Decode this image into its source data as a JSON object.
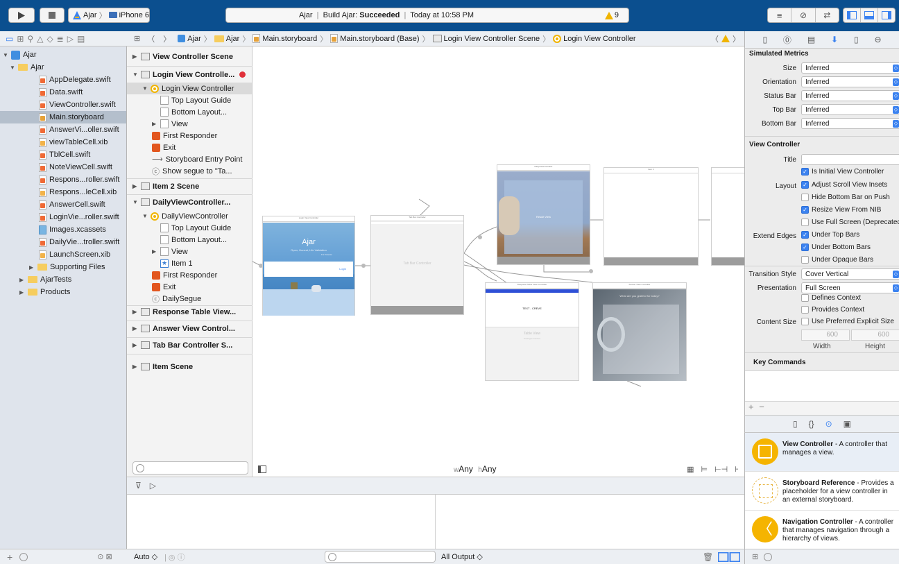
{
  "toolbar": {
    "scheme_name": "Ajar",
    "device_name": "iPhone 6",
    "status_project": "Ajar",
    "status_build_prefix": "Build Ajar: ",
    "status_build_result": "Succeeded",
    "status_time": "Today at 10:58 PM",
    "warning_count": "9"
  },
  "navigator": {
    "items": [
      {
        "label": "Ajar",
        "kind": "project"
      },
      {
        "label": "Ajar",
        "kind": "folder"
      },
      {
        "label": "AppDelegate.swift",
        "kind": "swift"
      },
      {
        "label": "Data.swift",
        "kind": "swift"
      },
      {
        "label": "ViewController.swift",
        "kind": "swift"
      },
      {
        "label": "Main.storyboard",
        "kind": "storyboard"
      },
      {
        "label": "AnswerVi...oller.swift",
        "kind": "swift"
      },
      {
        "label": "viewTableCell.xib",
        "kind": "xib"
      },
      {
        "label": "TblCell.swift",
        "kind": "swift"
      },
      {
        "label": "NoteViewCell.swift",
        "kind": "swift"
      },
      {
        "label": "Respons...roller.swift",
        "kind": "swift"
      },
      {
        "label": "Respons...leCell.xib",
        "kind": "xib"
      },
      {
        "label": "AnswerCell.swift",
        "kind": "swift"
      },
      {
        "label": "LoginVie...roller.swift",
        "kind": "swift"
      },
      {
        "label": "Images.xcassets",
        "kind": "assets"
      },
      {
        "label": "DailyVie...troller.swift",
        "kind": "swift"
      },
      {
        "label": "LaunchScreen.xib",
        "kind": "xib"
      },
      {
        "label": "Supporting Files",
        "kind": "folder"
      },
      {
        "label": "AjarTests",
        "kind": "folder"
      },
      {
        "label": "Products",
        "kind": "folder"
      }
    ]
  },
  "jumpbar": {
    "crumbs": [
      "Ajar",
      "Ajar",
      "Main.storyboard",
      "Main.storyboard (Base)",
      "Login View Controller Scene",
      "Login View Controller"
    ]
  },
  "outline": {
    "rows": [
      {
        "label": "View Controller Scene",
        "head": true
      },
      {
        "label": "Login View Controlle...",
        "head": true
      },
      {
        "label": "Login View Controller"
      },
      {
        "label": "Top Layout Guide"
      },
      {
        "label": "Bottom Layout..."
      },
      {
        "label": "View"
      },
      {
        "label": "First Responder"
      },
      {
        "label": "Exit"
      },
      {
        "label": "Storyboard Entry Point"
      },
      {
        "label": "Show segue to \"Ta..."
      },
      {
        "label": "Item 2 Scene",
        "head": true
      },
      {
        "label": "DailyViewController...",
        "head": true
      },
      {
        "label": "DailyViewController"
      },
      {
        "label": "Top Layout Guide"
      },
      {
        "label": "Bottom Layout..."
      },
      {
        "label": "View"
      },
      {
        "label": "Item 1"
      },
      {
        "label": "First Responder"
      },
      {
        "label": "Exit"
      },
      {
        "label": "DailySegue"
      },
      {
        "label": "Response Table View...",
        "head": true
      },
      {
        "label": "Answer View Control...",
        "head": true
      },
      {
        "label": "Tab Bar Controller S...",
        "head": true
      },
      {
        "label": "Item Scene",
        "head": true
      }
    ]
  },
  "canvas": {
    "login_title": "Login View Controller",
    "login_app": "Ajar",
    "login_tagline": "Open, Honest, Life Validation",
    "login_sub": "For Parents",
    "login_button": "Login",
    "tabbar_title": "Tab Bar Controller",
    "tabbar_label": "Tab Bar Controller",
    "daily_title": "DailyViewController",
    "daily_label": "Result View",
    "item2_title": "Item 2",
    "response_title": "Response Table View Controller",
    "response_cell": "TEXT - CREVE",
    "response_table": "Table View",
    "response_table_sub": "Prototype Content",
    "answer_title": "Answer View Controller",
    "answer_question": "What are you grateful for today?",
    "size_class_w_prefix": "w",
    "size_class_w": "Any",
    "size_class_h_prefix": "h",
    "size_class_h": "Any"
  },
  "debug": {
    "auto_label": "Auto ◇",
    "output_label": "All Output ◇"
  },
  "inspector": {
    "simulated_metrics": "Simulated Metrics",
    "metrics": [
      {
        "label": "Size",
        "value": "Inferred"
      },
      {
        "label": "Orientation",
        "value": "Inferred"
      },
      {
        "label": "Status Bar",
        "value": "Inferred"
      },
      {
        "label": "Top Bar",
        "value": "Inferred"
      },
      {
        "label": "Bottom Bar",
        "value": "Inferred"
      }
    ],
    "view_controller": "View Controller",
    "title_label": "Title",
    "title_value": "",
    "initial_vc": "Is Initial View Controller",
    "layout_label": "Layout",
    "layout_options": [
      {
        "label": "Adjust Scroll View Insets",
        "checked": true
      },
      {
        "label": "Hide Bottom Bar on Push",
        "checked": false
      },
      {
        "label": "Resize View From NIB",
        "checked": true
      },
      {
        "label": "Use Full Screen (Deprecated)",
        "checked": false
      }
    ],
    "extend_label": "Extend Edges",
    "extend_options": [
      {
        "label": "Under Top Bars",
        "checked": true
      },
      {
        "label": "Under Bottom Bars",
        "checked": true
      },
      {
        "label": "Under Opaque Bars",
        "checked": false
      }
    ],
    "transition_label": "Transition Style",
    "transition_value": "Cover Vertical",
    "presentation_label": "Presentation",
    "presentation_value": "Full Screen",
    "defines_context": "Defines Context",
    "provides_context": "Provides Context",
    "content_size_label": "Content Size",
    "preferred_size": "Use Preferred Explicit Size",
    "width_value": "600",
    "height_value": "600",
    "width_label": "Width",
    "height_label": "Height",
    "key_commands": "Key Commands"
  },
  "library": {
    "items": [
      {
        "title": "View Controller",
        "desc": " - A controller that manages a view.",
        "color": "#f5b400"
      },
      {
        "title": "Storyboard Reference",
        "desc": " - Provides a placeholder for a view controller in an external storyboard.",
        "color": "#f7d77a"
      },
      {
        "title": "Navigation Controller",
        "desc": " - A controller that manages navigation through a hierarchy of views.",
        "color": "#f5b400"
      }
    ]
  },
  "colors": {
    "toolbar_bg": "#0b4f8f",
    "accent_blue": "#3b82f0",
    "warning_yellow": "#f0b400",
    "error_red": "#e2561e"
  }
}
